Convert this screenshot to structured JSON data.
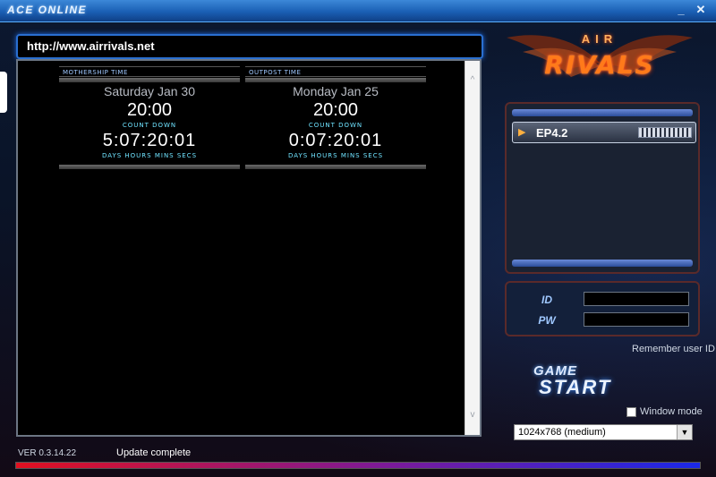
{
  "window": {
    "title": "ACE ONLINE",
    "minimize_label": "_",
    "close_label": "✕"
  },
  "browser": {
    "url": "http://www.airrivals.net",
    "scroll_up": "^",
    "scroll_down": "v",
    "timers": [
      {
        "header": "MOTHERSHIP TIME",
        "date": "Saturday Jan 30",
        "time": "20:00",
        "count_label": "COUNT DOWN",
        "countdown": "5:07:20:01",
        "units": "DAYS  HOURS  MINS  SECS"
      },
      {
        "header": "OUTPOST TIME",
        "date": "Monday Jan 25",
        "time": "20:00",
        "count_label": "COUNT DOWN",
        "countdown": "0:07:20:01",
        "units": "DAYS  HOURS  MINS  SECS"
      }
    ]
  },
  "logo": {
    "air": "AIR",
    "rivals": "RIVALS"
  },
  "server_list": {
    "items": [
      {
        "name": "EP4.2",
        "load": 0.85
      }
    ]
  },
  "login": {
    "id_label": "ID",
    "pw_label": "PW",
    "id_value": "",
    "pw_value": "",
    "remember_label": "Remember user ID"
  },
  "game_start": {
    "line1": "GAME",
    "line2": "START"
  },
  "options": {
    "window_mode_label": "Window mode",
    "window_mode_checked": false,
    "resolution_value": "1024x768 (medium)",
    "resolution_arrow": "▼"
  },
  "footer": {
    "version": "VER 0.3.14.22",
    "status": "Update complete",
    "progress": 1.0
  },
  "colors": {
    "titlebar": "#1a5fb4",
    "accent_blue": "#2a6fd0",
    "logo_orange": "#ff7a1a",
    "progress_start": "#e01020",
    "progress_end": "#1a28e8"
  }
}
